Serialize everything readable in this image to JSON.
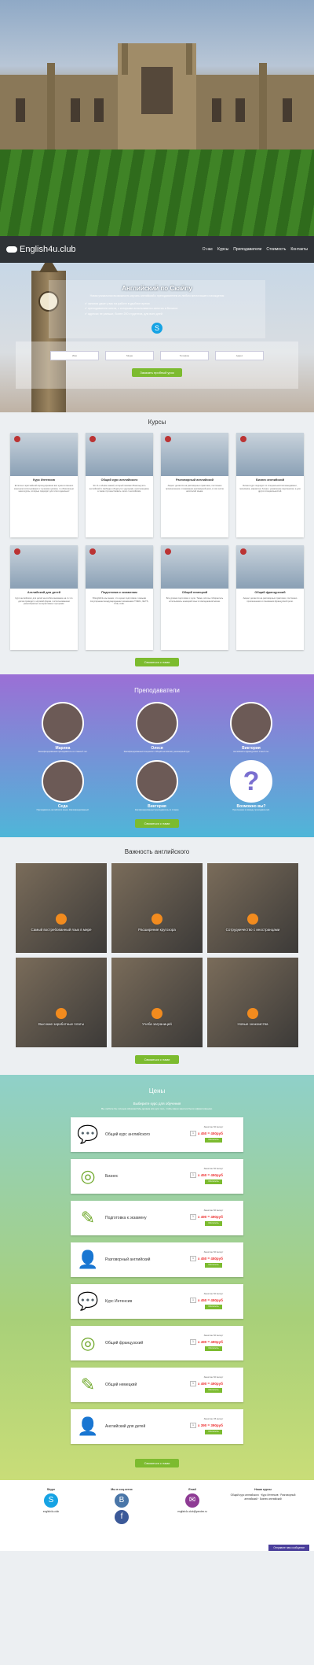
{
  "header": {
    "logo": "English4u.club",
    "menu": [
      "О нас",
      "Курсы",
      "Преподаватели",
      "Стоимость",
      "Контакты"
    ]
  },
  "intro": {
    "title": "Английский по Скайпу",
    "subtitle": "Новая уникальная возможность изучать английский с преподавателем из любого места вашего нахождения",
    "bullets": [
      "занятия даже у вас на работе в удобное время",
      "преподаватели места, с которыми испытываются занятия в Великих",
      "адресах не раньше, более 200 студентов, для всех дней"
    ],
    "fields": [
      "Имя",
      "Skype",
      "Телефон",
      "Адрес"
    ],
    "cta": "Заказать пробный урок"
  },
  "courses": {
    "title": "Курсы",
    "items": [
      {
        "name": "Курс Интенсив",
        "text": "Если вы в кратчайший период времени вас нужно в вашего конечном использовании с лучшими целями, то обязательно наши курсы, которые подходят для этого идеально!"
      },
      {
        "name": "Общий курс английского",
        "text": "Это 3-х объём знаний, который поможет Вам выучить английский и свободно общаться с друзьями, иностранцами, а также путешествовать легко с английским."
      },
      {
        "name": "Разговорный английский",
        "text": "Акцент делается на разговорных практиках, постоянно произношение и понимании разговорной речи, в том числе носителей языка."
      },
      {
        "name": "Бизнес английский",
        "text": "Бизнес курс подходит по специальностям менеджмент, экономика, маркетинг, бизнес, управление персоналом, а для других специальностей."
      },
      {
        "name": "Английский для детей",
        "text": "Курс английского для детей на особое внимание на то что детям проводит в игровой форме с использованием разнообразных интерактивных программ."
      },
      {
        "name": "Подготовка к экзаменам",
        "text": "В English4u мы знаем, что нужно подготовка с самыми популярными международными экзаменами TOEFL, IELTS, FCE, CAE."
      },
      {
        "name": "Общий немецкий",
        "text": "Все уровни подготовки с нуля. Также, всё вы собираетесь использовать немецкий язык в повседневной жизни."
      },
      {
        "name": "Общий французский",
        "text": "Акцент делается на разговорных практиках, постоянно произношения и понимания французской речи."
      }
    ],
    "cta": "Связаться с нами"
  },
  "teachers": {
    "title": "Преподаватели",
    "items": [
      {
        "name": "Марина",
        "text": "Квалифицированный преподаватель со стажем 5 лет."
      },
      {
        "name": "Олеся",
        "text": "Квалифицированный специалист. Общий английский, разговорный курс."
      },
      {
        "name": "Виктория",
        "text": "Английский и французский. Стаж 6 лет."
      },
      {
        "name": "Седа",
        "text": "Преподаватель английского языка. Квалифицированный."
      },
      {
        "name": "Виктория",
        "text": "Квалифицированный преподаватель со стажем."
      },
      {
        "name": "Возможно вы?",
        "text": "Приглашаем в команду преподавателей."
      }
    ],
    "cta": "Связаться с нами"
  },
  "importance": {
    "title": "Важность английского",
    "items": [
      "Самый востребованный язык в мире",
      "Расширение кругозора",
      "Сотрудничество с иностранцами",
      "Высокие заработные платы",
      "Учеба заграницей",
      "Новые знакомства"
    ],
    "cta": "Связаться с нами"
  },
  "prices": {
    "title": "Цены",
    "subtitle": "Выберите курс для обучения",
    "desc": "Вы любите бы личным образом! Мы делаем всё для того, чтобы ваши занятия были эффективными.",
    "items": [
      {
        "name": "Общий курс английского",
        "lesson": "Занятие 60 минут",
        "qty": "1",
        "price": "x 450 = 450руб",
        "btn": "Оплатить",
        "icon": "💬"
      },
      {
        "name": "Бизнес",
        "lesson": "Занятие 60 минут",
        "qty": "1",
        "price": "x 450 = 450руб",
        "btn": "Оплатить",
        "icon": "◎"
      },
      {
        "name": "Подготовка к экзамену",
        "lesson": "Занятие 60 минут",
        "qty": "1",
        "price": "x 490 = 490руб",
        "btn": "Оплатить",
        "icon": "✎"
      },
      {
        "name": "Разговорный английский",
        "lesson": "Занятие 60 минут",
        "qty": "1",
        "price": "x 450 = 450руб",
        "btn": "Оплатить",
        "icon": "👤"
      },
      {
        "name": "Курс Интенсив",
        "lesson": "Занятие 60 минут",
        "qty": "1",
        "price": "x 450 = 450руб",
        "btn": "Оплатить",
        "icon": "💬"
      },
      {
        "name": "Общий французский",
        "lesson": "Занятие 60 минут",
        "qty": "1",
        "price": "x 490 = 490руб",
        "btn": "Оплатить",
        "icon": "◎"
      },
      {
        "name": "Общий немецкий",
        "lesson": "Занятие 60 минут",
        "qty": "1",
        "price": "x 490 = 490руб",
        "btn": "Оплатить",
        "icon": "✎"
      },
      {
        "name": "Английский для детей",
        "lesson": "Занятие 45 минут",
        "qty": "1",
        "price": "x 390 = 390руб",
        "btn": "Оплатить",
        "icon": "👤"
      }
    ],
    "cta": "Связаться с нами"
  },
  "footer": {
    "cols": [
      {
        "title": "Skype",
        "text": "english4u.club",
        "icon": "S",
        "color": "#16a3e4"
      },
      {
        "title": "Мы в соц.сетях",
        "text": "",
        "icon": "В",
        "color": "#4a76a8"
      },
      {
        "title": "Email",
        "text": "english4u.club@yandex.ru",
        "icon": "✉",
        "color": "#8e3b94"
      },
      {
        "title": "Наши курсы",
        "text": "Общий курс английского · Курс Интенсив · Разговорный английский · Бизнес английский",
        "icon": "",
        "color": "#ffffff"
      }
    ],
    "chat": "Отправьте нам сообщение"
  }
}
